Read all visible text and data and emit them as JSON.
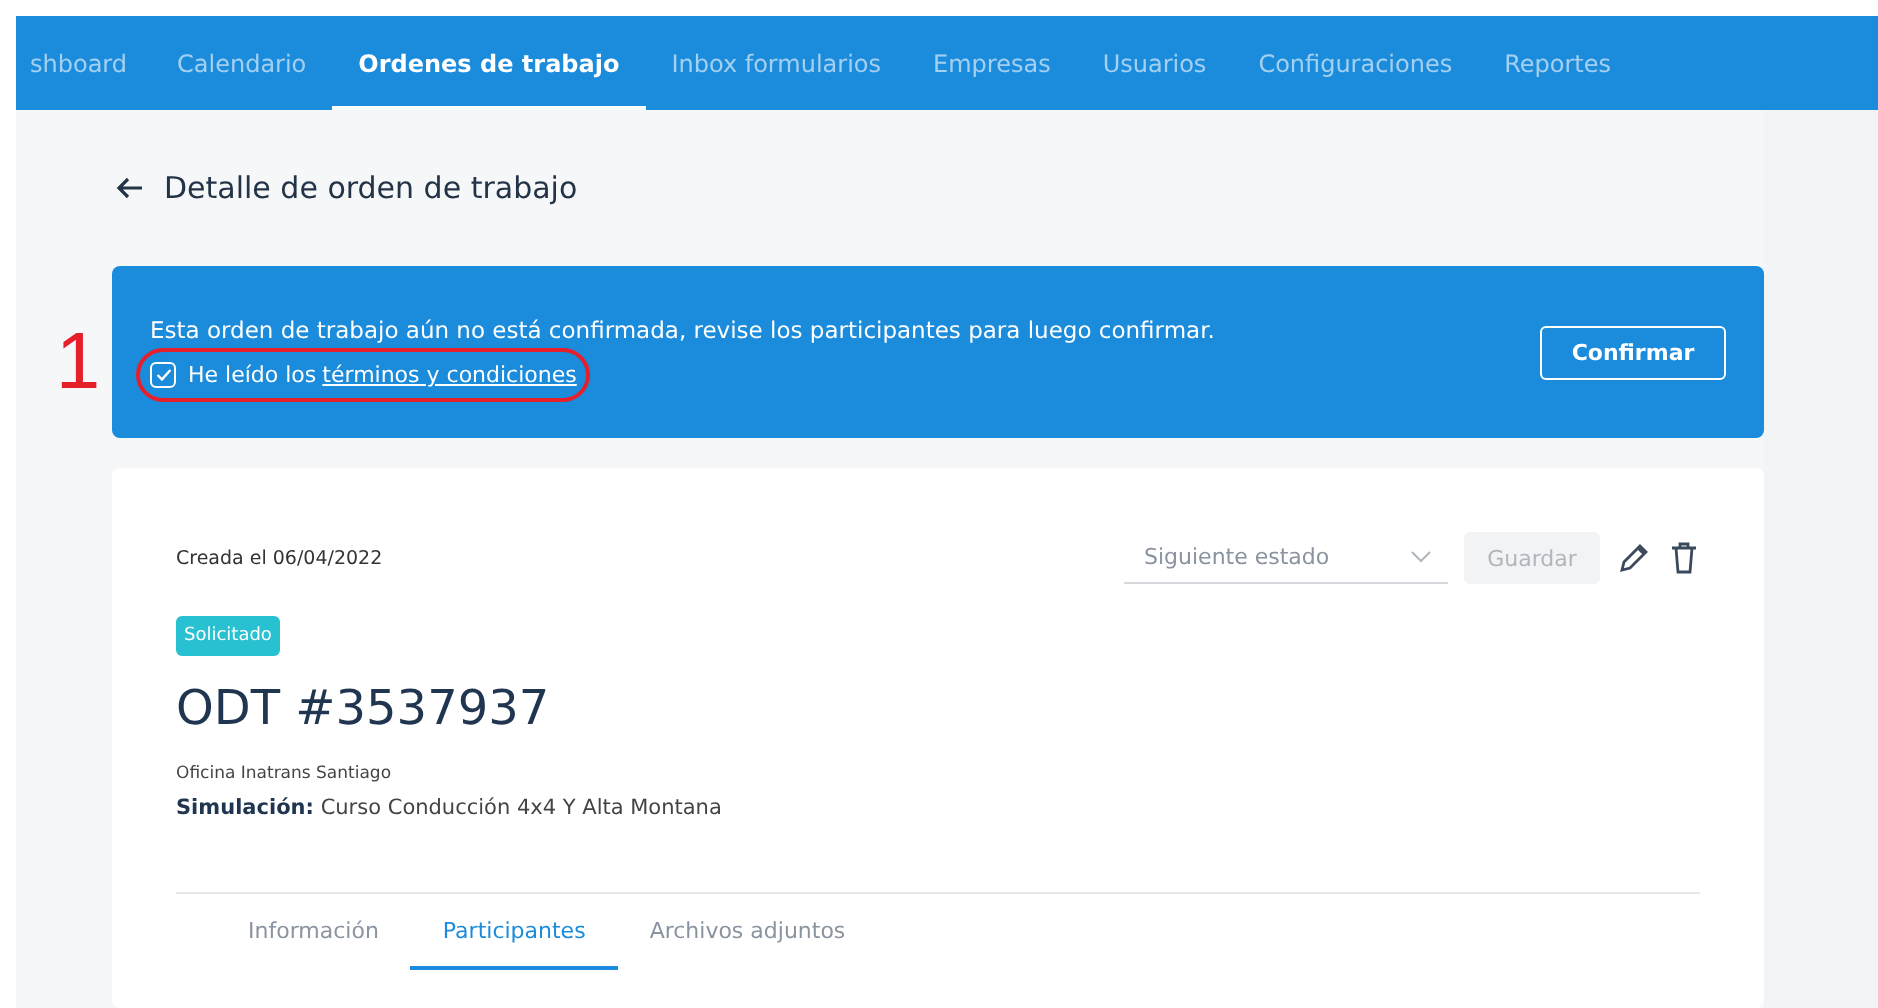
{
  "nav": {
    "items": [
      {
        "label": "shboard",
        "selected": false
      },
      {
        "label": "Calendario",
        "selected": false
      },
      {
        "label": "Ordenes de trabajo",
        "selected": true
      },
      {
        "label": "Inbox formularios",
        "selected": false
      },
      {
        "label": "Empresas",
        "selected": false
      },
      {
        "label": "Usuarios",
        "selected": false
      },
      {
        "label": "Configuraciones",
        "selected": false
      },
      {
        "label": "Reportes",
        "selected": false
      }
    ]
  },
  "page_title": "Detalle de orden de trabajo",
  "annotation": {
    "label": "1"
  },
  "banner": {
    "message": "Esta orden de trabajo aún no está confirmada, revise los participantes para luego confirmar.",
    "checkbox": {
      "label": "He leído los",
      "link": "términos y condiciones",
      "checked": true
    },
    "button": "Confirmar"
  },
  "card": {
    "created": "Creada el 06/04/2022",
    "status_select": {
      "placeholder": "Siguiente estado"
    },
    "save_button": {
      "label": "Guardar",
      "disabled": true
    },
    "status_badge": "Solicitado",
    "title": "ODT #3537937",
    "office": "Oficina Inatrans Santiago",
    "detail": "**Simulación:** Curso Conducción 4x4 Y Alta Montana",
    "tabs": [
      {
        "label": "Información",
        "selected": false
      },
      {
        "label": "Participantes",
        "selected": true
      },
      {
        "label": "Archivos adjuntos",
        "selected": false
      }
    ]
  }
}
